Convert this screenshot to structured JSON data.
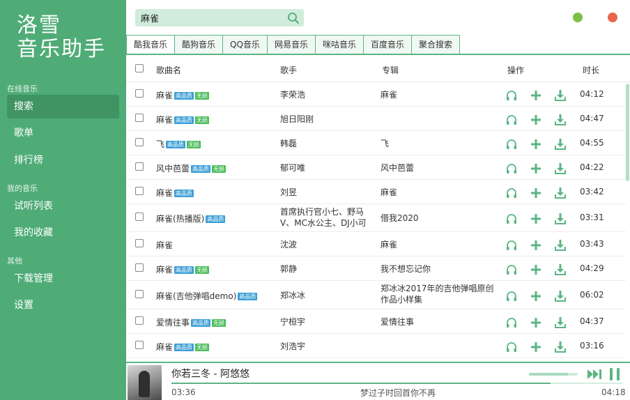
{
  "app": {
    "logo_line1": "洛雪",
    "logo_line2": "音乐助手"
  },
  "colors": {
    "accent": "#4fac77",
    "accent_dark": "#3f9462",
    "badge_hq": "#3b9ed6",
    "badge_lossless": "#4bbd5b",
    "win_min": "#7cc143",
    "win_close": "#e8644c"
  },
  "sidebar": {
    "sections": [
      {
        "title": "在线音乐",
        "items": [
          {
            "label": "搜索",
            "active": true
          },
          {
            "label": "歌单"
          },
          {
            "label": "排行榜"
          }
        ]
      },
      {
        "title": "我的音乐",
        "items": [
          {
            "label": "试听列表"
          },
          {
            "label": "我的收藏"
          }
        ]
      },
      {
        "title": "其他",
        "items": [
          {
            "label": "下载管理"
          },
          {
            "label": "设置"
          }
        ]
      }
    ]
  },
  "search": {
    "value": "麻雀",
    "icon": "search-icon"
  },
  "window_controls": [
    "minimize",
    "close"
  ],
  "tabs": [
    {
      "label": "酷我音乐",
      "active": true
    },
    {
      "label": "酷狗音乐"
    },
    {
      "label": "QQ音乐"
    },
    {
      "label": "网易音乐"
    },
    {
      "label": "咪咕音乐"
    },
    {
      "label": "百度音乐"
    },
    {
      "label": "聚合搜索"
    }
  ],
  "table": {
    "headers": {
      "name": "歌曲名",
      "singer": "歌手",
      "album": "专辑",
      "ops": "操作",
      "duration": "时长"
    },
    "badge_labels": {
      "hq": "高品质",
      "lossless": "无损"
    },
    "op_icons": [
      "headphones-icon",
      "add-icon",
      "download-icon"
    ],
    "rows": [
      {
        "name": "麻雀",
        "hq": true,
        "lossless": true,
        "singer": "李荣浩",
        "album": "麻雀",
        "duration": "04:12"
      },
      {
        "name": "麻雀",
        "hq": true,
        "lossless": true,
        "singer": "旭日阳刚",
        "album": "",
        "duration": "04:47"
      },
      {
        "name": "飞",
        "hq": true,
        "lossless": true,
        "singer": "韩磊",
        "album": "飞",
        "duration": "04:55"
      },
      {
        "name": "风中芭蕾",
        "hq": true,
        "lossless": true,
        "singer": "郁可唯",
        "album": "风中芭蕾",
        "duration": "04:22"
      },
      {
        "name": "麻雀",
        "hq": true,
        "lossless": false,
        "singer": "刘昱",
        "album": "麻雀",
        "duration": "03:42"
      },
      {
        "name": "麻雀(热播版)",
        "hq": true,
        "lossless": false,
        "singer": "首席执行官小七、野马V、MC水公主、DJ小可",
        "album": "借我2020",
        "duration": "03:31"
      },
      {
        "name": "麻雀",
        "hq": false,
        "lossless": false,
        "singer": "沈波",
        "album": "麻雀",
        "duration": "03:43"
      },
      {
        "name": "麻雀",
        "hq": true,
        "lossless": true,
        "singer": "郭静",
        "album": "我不想忘记你",
        "duration": "04:29"
      },
      {
        "name": "麻雀(吉他弹唱demo)",
        "hq": true,
        "lossless": false,
        "singer": "郑冰冰",
        "album": "郑冰冰2017年的吉他弹唱原创作品小样集",
        "duration": "06:02"
      },
      {
        "name": "爱情往事",
        "hq": true,
        "lossless": true,
        "singer": "宁桓宇",
        "album": "爱情往事",
        "duration": "04:37"
      },
      {
        "name": "麻雀",
        "hq": true,
        "lossless": true,
        "singer": "刘浩宇",
        "album": "",
        "duration": "03:16"
      }
    ]
  },
  "player": {
    "title": "你若三冬 - 阿悠悠",
    "current_time": "03:36",
    "total_time": "04:18",
    "lyric": "梦过子时回首你不再",
    "progress": 0.84,
    "volume": 0.8
  }
}
